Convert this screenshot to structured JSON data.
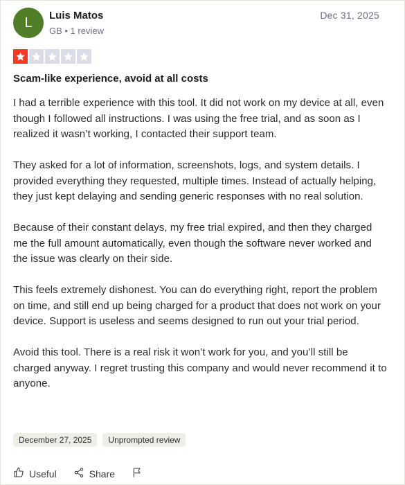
{
  "reviewer": {
    "initial": "L",
    "name": "Luis Matos",
    "meta": "GB • 1 review",
    "avatar_color": "#4f7e27"
  },
  "review_date": "Dec 31, 2025",
  "rating": {
    "value": 1,
    "max": 5,
    "filled_color": "#ff3722",
    "empty_color": "#dcdce6"
  },
  "title": "Scam-like experience, avoid at all costs",
  "body": [
    "I had a terrible experience with this tool. It did not work on my device at all, even though I followed all instructions. I was using the free trial, and as soon as I realized it wasn’t working, I contacted their support team.",
    "They asked for a lot of information, screenshots, logs, and system details. I provided everything they requested, multiple times. Instead of actually helping, they just kept delaying and sending generic responses with no real solution.",
    "Because of their constant delays, my free trial expired, and then they charged me the full amount automatically, even though the software never worked and the issue was clearly on their side.",
    "This feels extremely dishonest. You can do everything right, report the problem on time, and still end up being charged for a product that does not work on your device. Support is useless and seems designed to run out your trial period.",
    "Avoid this tool. There is a real risk it won’t work for you, and you’ll still be charged anyway. I regret trusting this company and would never recommend it to anyone."
  ],
  "tags": {
    "experience_date": "December 27, 2025",
    "review_type": "Unprompted review"
  },
  "actions": {
    "useful_label": "Useful",
    "share_label": "Share",
    "useful_icon": "thumbs-up-icon",
    "share_icon": "share-icon",
    "report_icon": "flag-icon"
  }
}
